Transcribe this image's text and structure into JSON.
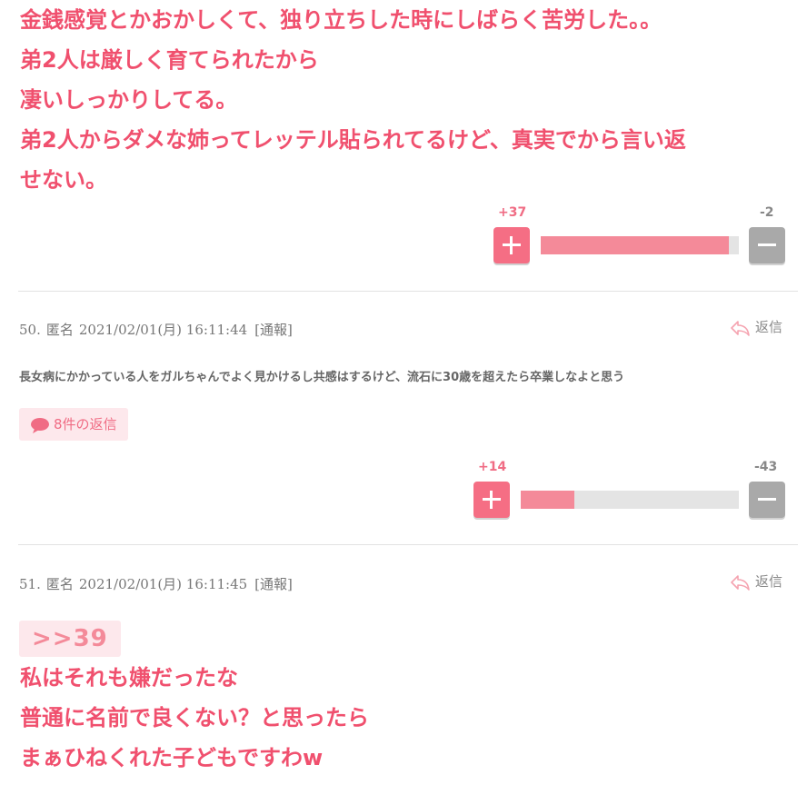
{
  "comment49": {
    "lines": [
      "金銭感覚とかおかしくて、独り立ちした時にしばらく苦労した。。",
      "弟2人は厳しく育てられたから",
      "凄いしっかりしてる。",
      "弟2人からダメな姉ってレッテル貼られてるけど、真実でから言い返",
      "せない。"
    ],
    "votes": {
      "plus": "+37",
      "minus": "-2",
      "ratio": 0.949
    }
  },
  "comment50": {
    "number": "50.",
    "author": "匿名",
    "datetime": "2021/02/01(月) 16:11:44",
    "report": "[通報]",
    "reply_label": "返信",
    "body": "長女病にかかっている人をガルちゃんでよく見かけるし共感はするけど、流石に30歳を超えたら卒業しなよと思う",
    "replies_count": "8件の返信",
    "votes": {
      "plus": "+14",
      "minus": "-43",
      "ratio": 0.246
    }
  },
  "comment51": {
    "number": "51.",
    "author": "匿名",
    "datetime": "2021/02/01(月) 16:11:45",
    "report": "[通報]",
    "reply_label": "返信",
    "anchor": ">>39",
    "lines": [
      "私はそれも嫌だったな",
      "普通に名前で良くない？と思ったら",
      "まぁひねくれた子どもですわw"
    ]
  },
  "colors": {
    "accent": "#f0506e",
    "plus_button": "#f56e84",
    "minus_button": "#a9a9a9",
    "bar_fill": "#f48a99",
    "badge_bg": "#fde8ec"
  },
  "icons": {
    "plus": "plus-icon",
    "minus": "minus-icon",
    "reply": "reply-arrow-icon",
    "replies": "speech-bubble-icon"
  }
}
